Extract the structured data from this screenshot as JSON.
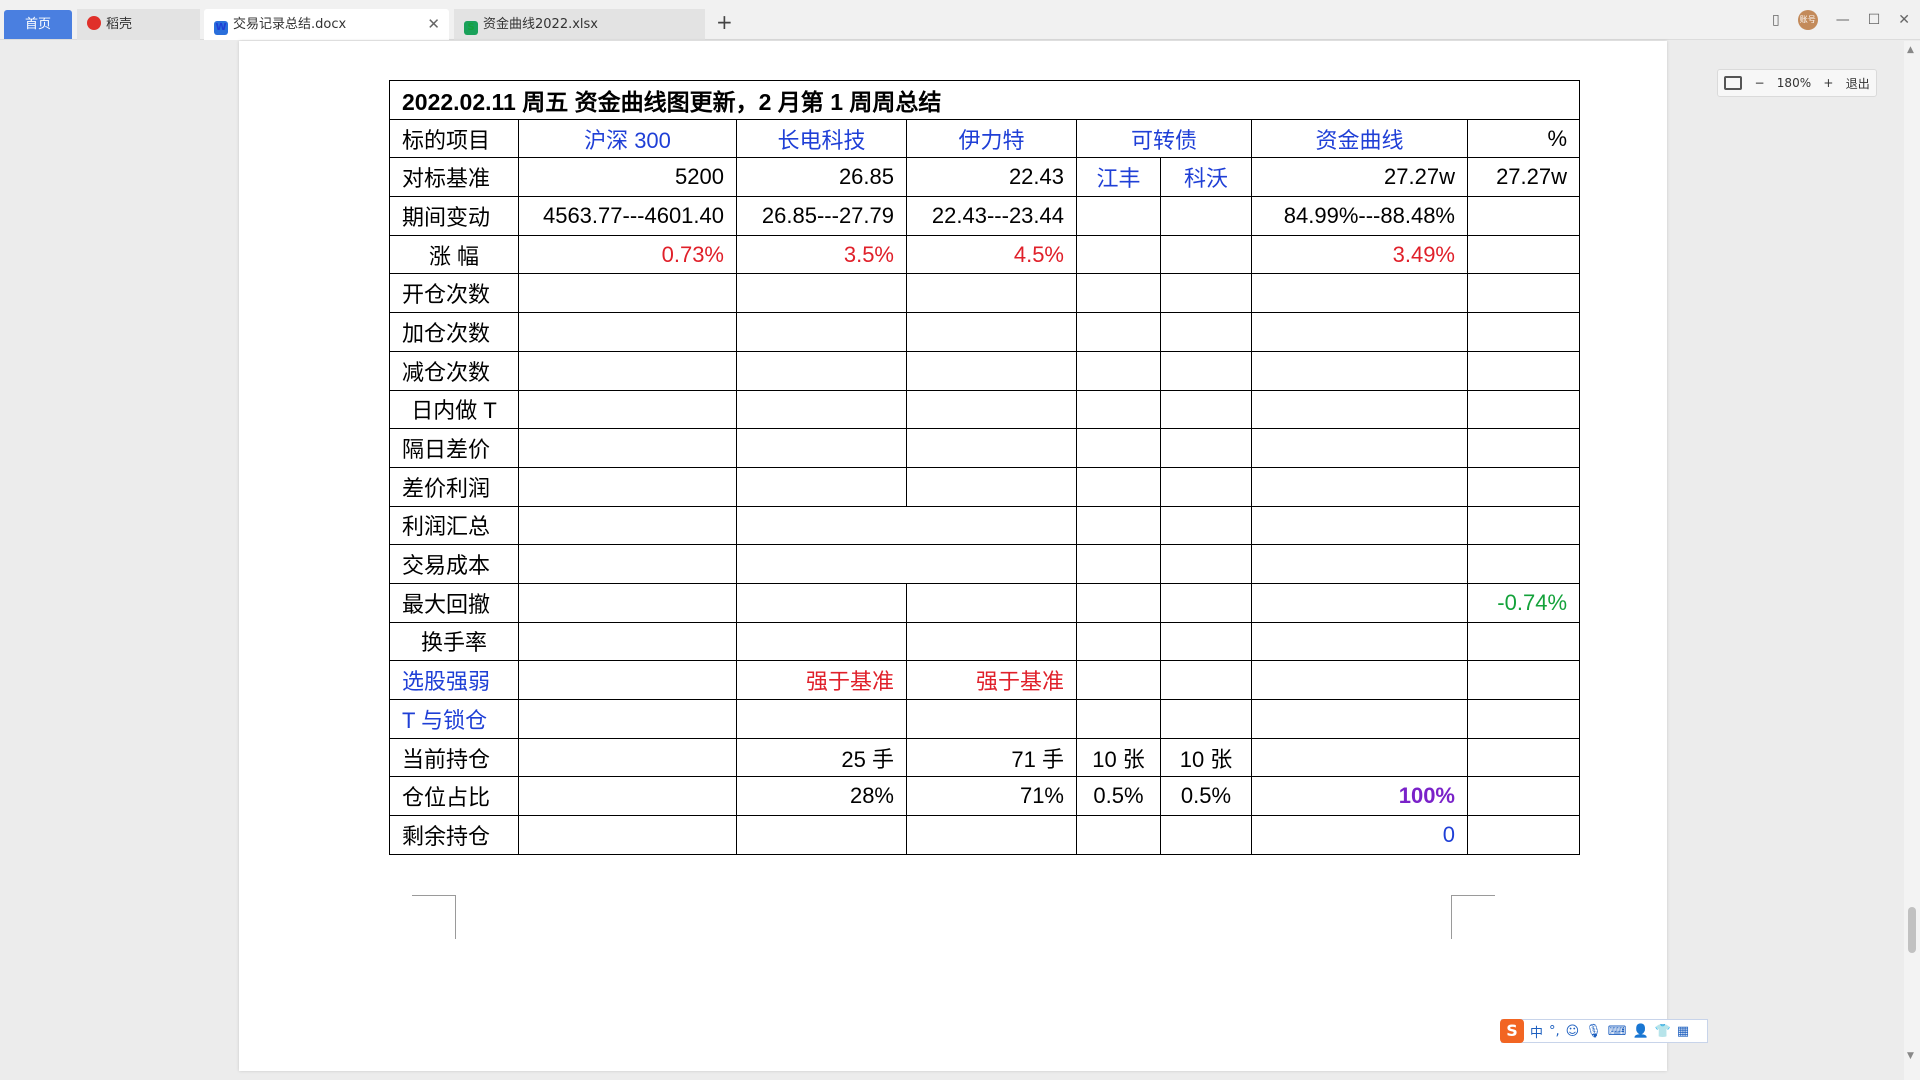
{
  "tabs": {
    "home": "首页",
    "daoke": "稻壳",
    "doc": "交易记录总结.docx",
    "xls": "资金曲线2022.xlsx"
  },
  "icons": {
    "daoke": "daoke-logo-icon",
    "doc": "writer-doc-icon",
    "xls": "spreadsheet-icon",
    "close": "close-icon",
    "new_tab": "plus-icon"
  },
  "window": {
    "avatar": "账号"
  },
  "zoom": {
    "value": "180%",
    "exit": "退出"
  },
  "table": {
    "title": "2022.02.11  周五  资金曲线图更新，2 月第 1 周周总结",
    "header": {
      "label": "标的项目",
      "c1": "沪深 300",
      "c2": "长电科技",
      "c3": "伊力特",
      "c4": "可转债",
      "c5": "资金曲线",
      "c6": "%"
    },
    "rows": {
      "benchmark": {
        "label": "对标基准",
        "c1": "5200",
        "c2": "26.85",
        "c3": "22.43",
        "c4a": "江丰",
        "c4b": "科沃",
        "c5": "27.27w",
        "c6": "27.27w"
      },
      "change": {
        "label": "期间变动",
        "c1": "4563.77---4601.40",
        "c2": "26.85---27.79",
        "c3": "22.43---23.44",
        "c5": "84.99%---88.48%"
      },
      "rise": {
        "label": "涨  幅",
        "c1": "0.73%",
        "c2": "3.5%",
        "c3": "4.5%",
        "c5": "3.49%"
      },
      "open": {
        "label": "开仓次数"
      },
      "add": {
        "label": "加仓次数"
      },
      "reduce": {
        "label": "减仓次数"
      },
      "intraday": {
        "label": "日内做 T"
      },
      "overnight": {
        "label": "隔日差价"
      },
      "spread_profit": {
        "label": "差价利润"
      },
      "profit_total": {
        "label": "利润汇总"
      },
      "cost": {
        "label": "交易成本"
      },
      "drawdown": {
        "label": "最大回撤",
        "c6": "-0.74%"
      },
      "turnover": {
        "label": "换手率"
      },
      "stock_pick": {
        "label": "选股强弱",
        "c2": "强于基准",
        "c3": "强于基准"
      },
      "t_lock": {
        "label": "T 与锁仓"
      },
      "holding": {
        "label": "当前持仓",
        "c2": "25 手",
        "c3": "71 手",
        "c4a": "10 张",
        "c4b": "10 张"
      },
      "ratio": {
        "label": "仓位占比",
        "c2": "28%",
        "c3": "71%",
        "c4a": "0.5%",
        "c4b": "0.5%",
        "c5": "100%"
      },
      "remain": {
        "label": "剩余持仓",
        "c5": "0"
      }
    }
  },
  "ime": {
    "mode": "中",
    "punct": "°,"
  },
  "colors": {
    "blue_text": "#1f3fd6",
    "red_text": "#e0202a",
    "green_text": "#13a23a",
    "purple_text": "#7a22c9",
    "home_tab": "#4a7fe0"
  }
}
